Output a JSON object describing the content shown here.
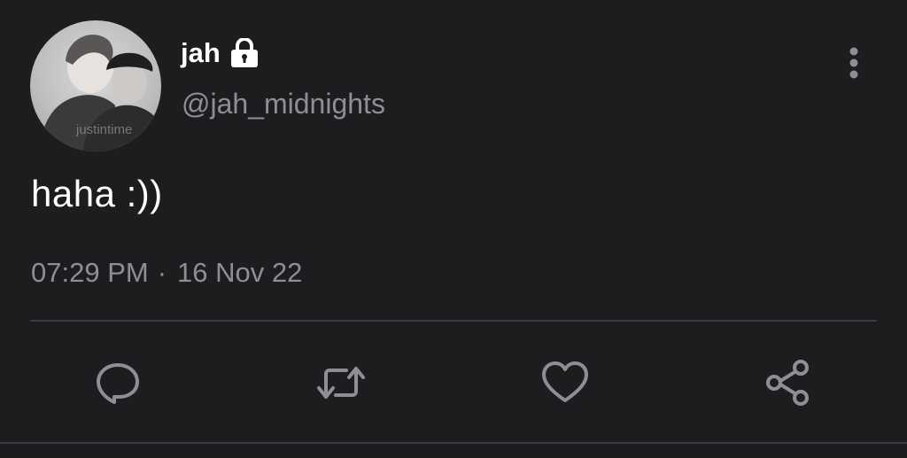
{
  "author": {
    "display_name": "jah",
    "handle": "@jah_midnights",
    "protected": true,
    "avatar_watermark": "justintime"
  },
  "tweet": {
    "text": "haha :))",
    "time": "07:29 PM",
    "separator": "·",
    "date": "16 Nov 22"
  },
  "icons": {
    "lock": "lock-icon",
    "more": "more-vertical-icon",
    "reply": "reply-icon",
    "retweet": "retweet-icon",
    "like": "heart-icon",
    "share": "share-icon"
  },
  "colors": {
    "background": "#1c1d1f",
    "primary_text": "#ffffff",
    "secondary_text": "#8e8f93",
    "icon": "#8e8f93",
    "divider": "#3a3b3e"
  }
}
